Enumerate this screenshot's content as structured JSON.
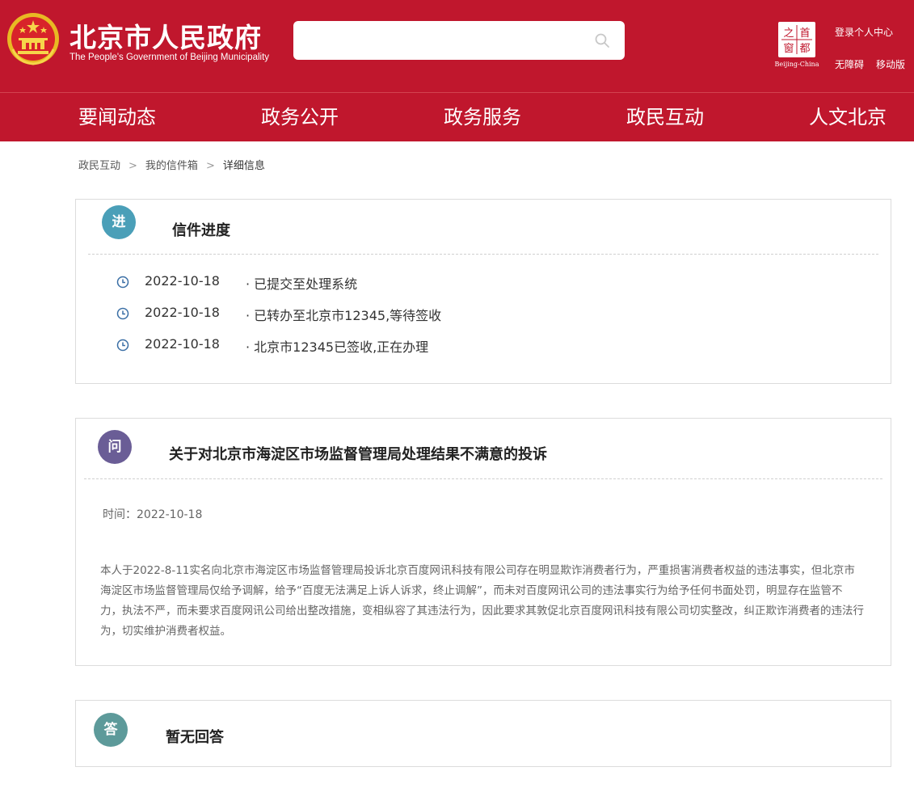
{
  "header": {
    "title": "北京市人民政府",
    "subtitle": "The People's Government of Beijing Municipality",
    "search": {
      "value": "",
      "placeholder": ""
    },
    "capital_logo": {
      "chars": [
        "之",
        "首",
        "窗",
        "都"
      ],
      "label": "Beijing-China"
    },
    "links": {
      "login": "登录个人中心",
      "accessible": "无障碍",
      "mobile": "移动版"
    },
    "brand_color": "#c0172d"
  },
  "nav": {
    "items": [
      "要闻动态",
      "政务公开",
      "政务服务",
      "政民互动",
      "人文北京"
    ]
  },
  "breadcrumb": {
    "items": [
      "政民互动",
      "我的信件箱",
      "详细信息"
    ],
    "separator": ">"
  },
  "progress": {
    "badge": "进",
    "title": "信件进度",
    "rows": [
      {
        "date": "2022-10-18",
        "text": "· 已提交至处理系统"
      },
      {
        "date": "2022-10-18",
        "text": "· 已转办至北京市12345,等待签收"
      },
      {
        "date": "2022-10-18",
        "text": "· 北京市12345已签收,正在办理"
      }
    ]
  },
  "question": {
    "badge": "问",
    "title": "关于对北京市海淀区市场监督管理局处理结果不满意的投诉",
    "time": "时间：2022-10-18",
    "body": "本人于2022-8-11实名向北京市海淀区市场监督管理局投诉北京百度网讯科技有限公司存在明显欺诈消费者行为，严重损害消费者权益的违法事实，但北京市海淀区市场监督管理局仅给予调解，给予“百度无法满足上诉人诉求，终止调解”，而未对百度网讯公司的违法事实行为给予任何书面处罚，明显存在监管不力，执法不严，而未要求百度网讯公司给出整改措施，变相纵容了其违法行为，因此要求其敦促北京百度网讯科技有限公司切实整改，纠正欺诈消费者的违法行为，切实维护消费者权益。"
  },
  "answer": {
    "badge": "答",
    "title": "暂无回答"
  },
  "colors": {
    "badge_progress": "#4a9fb8",
    "badge_question": "#6a5d96",
    "badge_answer": "#5d9a9a",
    "clock": "#3a6ea5"
  },
  "icons": [
    "national-emblem-icon",
    "search-icon",
    "clock-icon"
  ]
}
